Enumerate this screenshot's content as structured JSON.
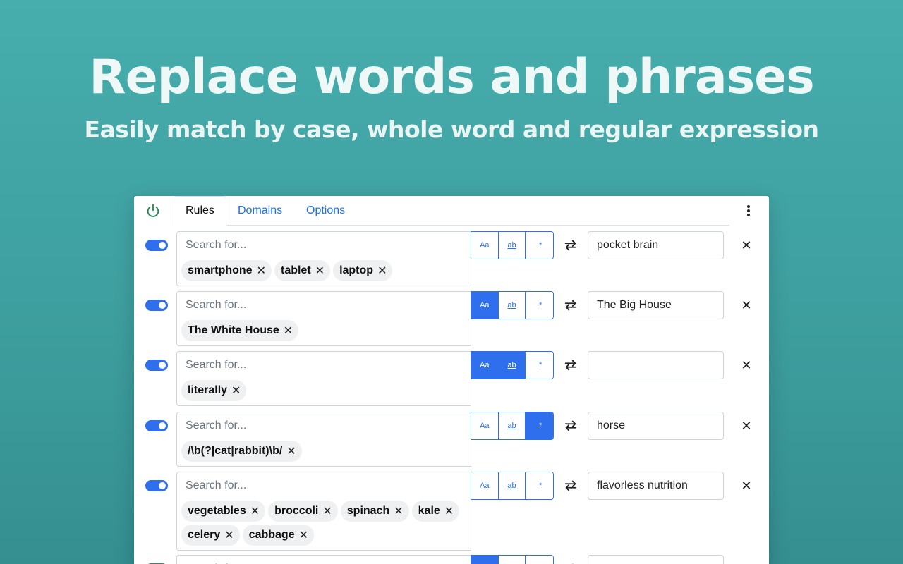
{
  "hero": {
    "title": "Replace words and phrases",
    "subtitle": "Easily match by case, whole word and regular expression"
  },
  "tabs": [
    {
      "label": "Rules",
      "active": true
    },
    {
      "label": "Domains",
      "active": false
    },
    {
      "label": "Options",
      "active": false
    }
  ],
  "search_placeholder": "Search for...",
  "option_labels": {
    "case": "Aa",
    "word": "ab",
    "regex": ".*"
  },
  "rules": [
    {
      "enabled": true,
      "terms": [
        "smartphone",
        "tablet",
        "laptop"
      ],
      "match_case": false,
      "whole_word": false,
      "regex": false,
      "replacement": "pocket brain"
    },
    {
      "enabled": true,
      "terms": [
        "The White House"
      ],
      "match_case": true,
      "whole_word": false,
      "regex": false,
      "replacement": "The Big House"
    },
    {
      "enabled": true,
      "terms": [
        "literally"
      ],
      "match_case": true,
      "whole_word": true,
      "regex": false,
      "replacement": ""
    },
    {
      "enabled": true,
      "terms": [
        "/\\b(?|cat|rabbit)\\b/"
      ],
      "match_case": false,
      "whole_word": false,
      "regex": true,
      "replacement": "horse"
    },
    {
      "enabled": true,
      "terms": [
        "vegetables",
        "broccoli",
        "spinach",
        "kale",
        "celery",
        "cabbage"
      ],
      "match_case": false,
      "whole_word": false,
      "regex": false,
      "replacement": "flavorless nutrition"
    },
    {
      "enabled": true,
      "terms": [],
      "match_case": true,
      "whole_word": false,
      "regex": false,
      "replacement": ""
    }
  ],
  "colors": {
    "accent": "#2f6fed",
    "power": "#1e8a4c"
  }
}
